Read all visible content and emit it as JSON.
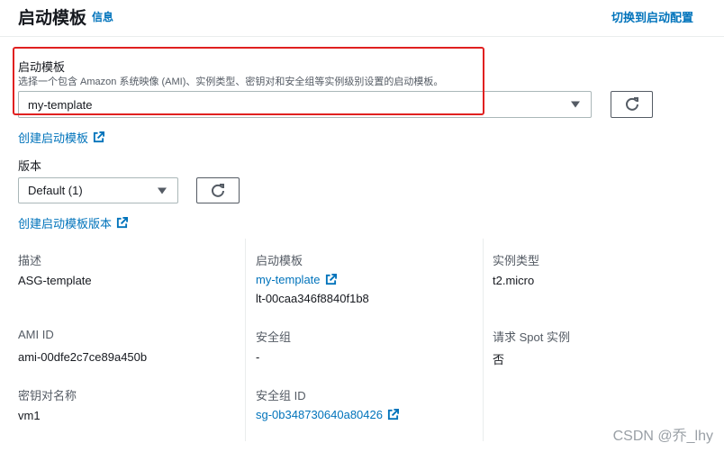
{
  "header": {
    "title": "启动模板",
    "info_label": "信息",
    "switch_label": "切换到启动配置"
  },
  "template_select": {
    "label": "启动模板",
    "description": "选择一个包含 Amazon 系统映像 (AMI)、实例类型、密钥对和安全组等实例级别设置的启动模板。",
    "value": "my-template"
  },
  "create_template_link": "创建启动模板",
  "version_select": {
    "label": "版本",
    "value": "Default (1)"
  },
  "create_version_link": "创建启动模板版本",
  "details": {
    "description_key": "描述",
    "description_value": "ASG-template",
    "template_key": "启动模板",
    "template_name": "my-template",
    "template_id": "lt-00caa346f8840f1b8",
    "instance_type_key": "实例类型",
    "instance_type_value": "t2.micro",
    "ami_key": "AMI ID",
    "ami_value": "ami-00dfe2c7ce89a450b",
    "sg_key": "安全组",
    "sg_value": "-",
    "spot_key": "请求 Spot 实例",
    "spot_value": "否",
    "keypair_key": "密钥对名称",
    "keypair_value": "vm1",
    "sg_id_key": "安全组 ID",
    "sg_id_value": "sg-0b348730640a80426"
  },
  "watermark": "CSDN @乔_lhy",
  "colors": {
    "link": "#0073bb",
    "highlight": "#e02020"
  }
}
